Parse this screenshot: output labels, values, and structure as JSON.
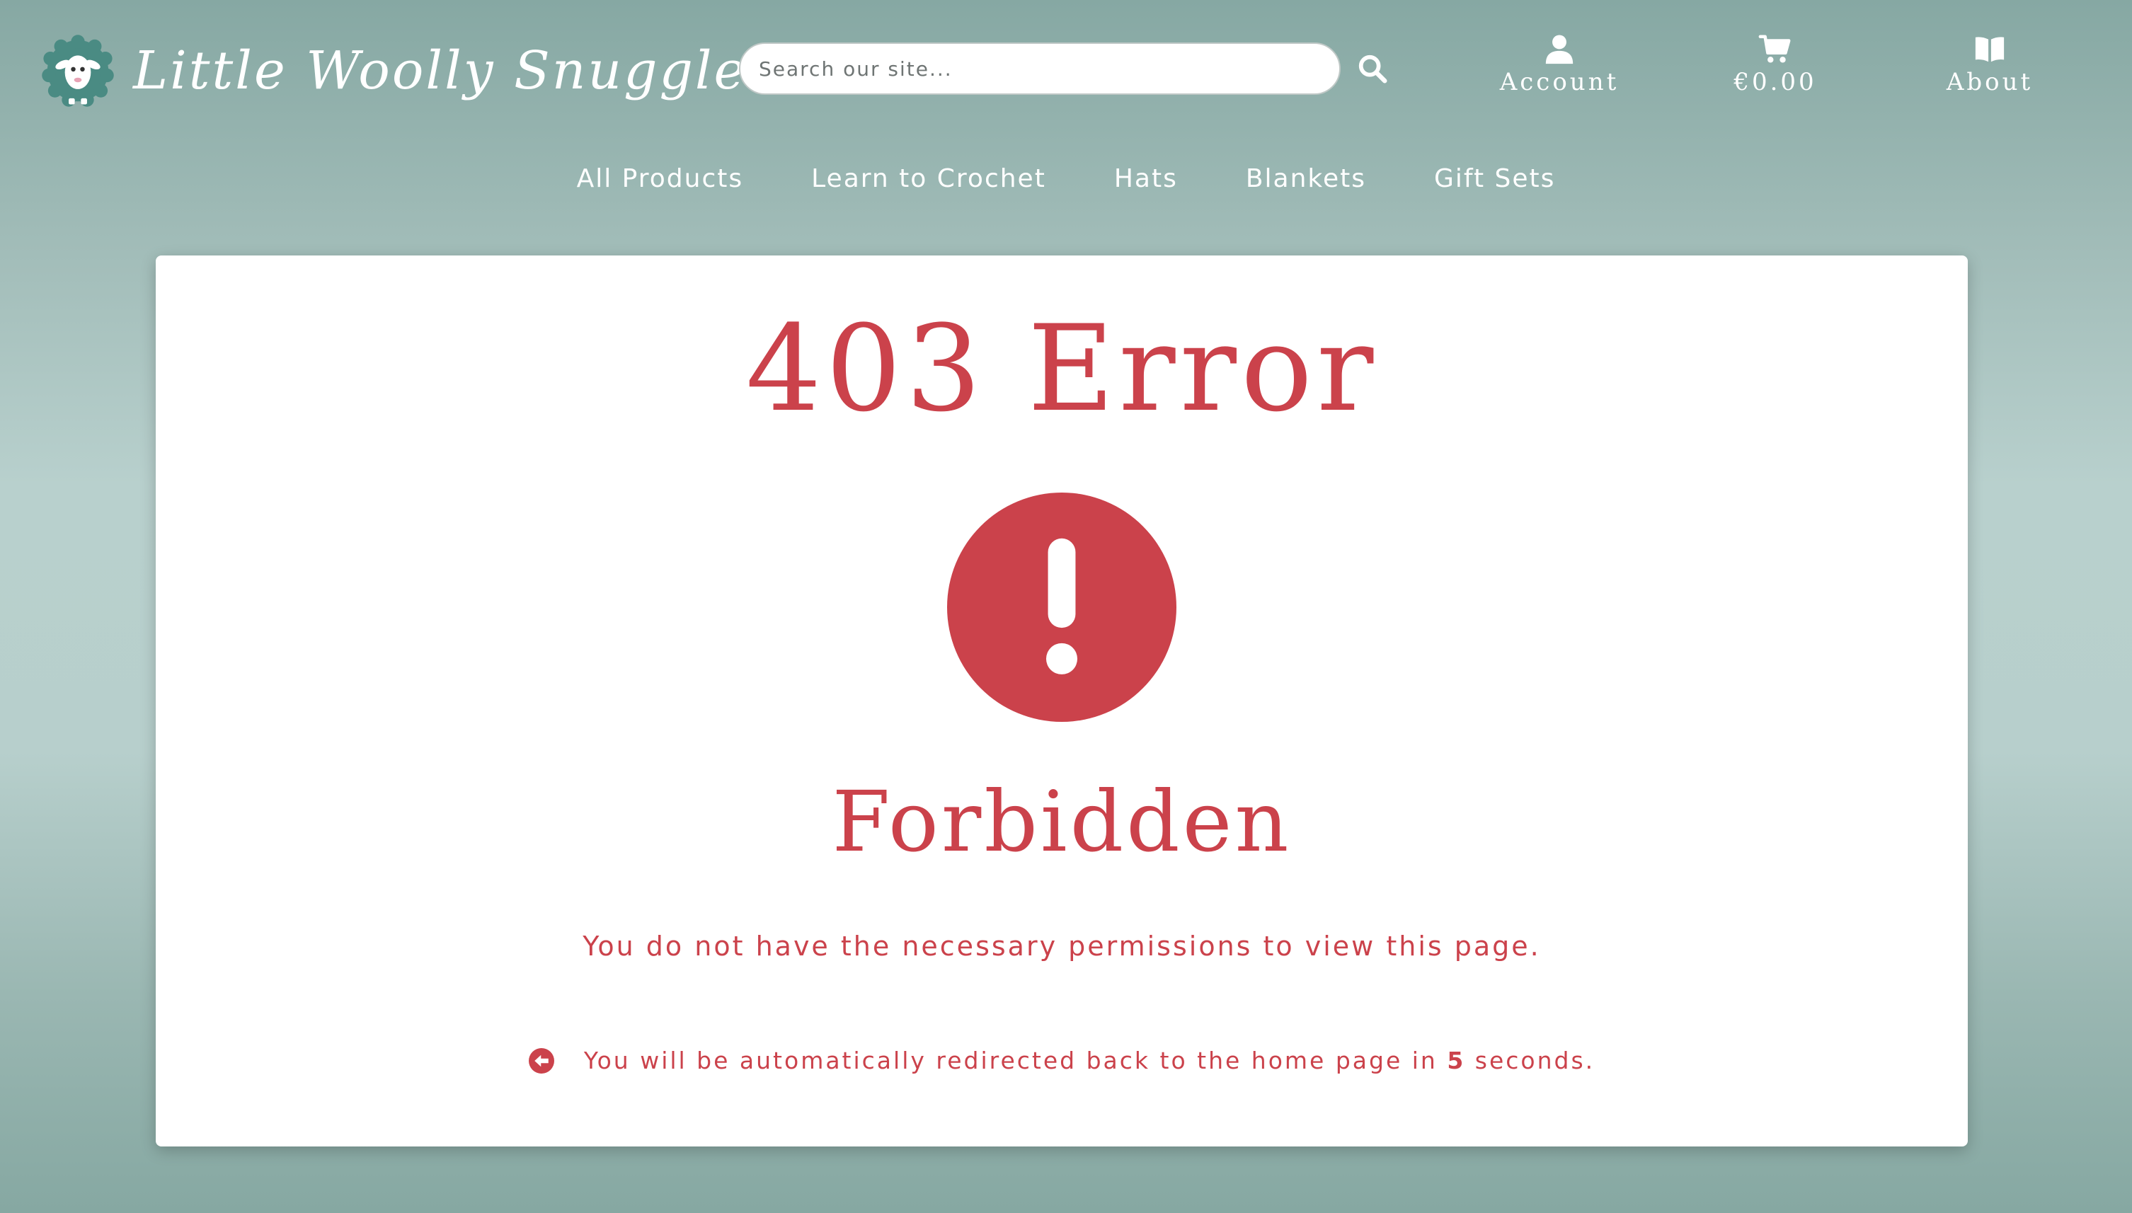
{
  "header": {
    "brand": "Little Woolly Snuggles",
    "search": {
      "placeholder": "Search our site..."
    },
    "account_label": "Account",
    "cart_total": "€0.00",
    "about_label": "About"
  },
  "nav": {
    "items": [
      {
        "label": "All Products"
      },
      {
        "label": "Learn to Crochet"
      },
      {
        "label": "Hats"
      },
      {
        "label": "Blankets"
      },
      {
        "label": "Gift Sets"
      }
    ]
  },
  "error": {
    "title": "403 Error",
    "heading": "Forbidden",
    "message": "You do not have the necessary permissions to view this page.",
    "redirect_prefix": "You will be automatically redirected back to the home page in",
    "redirect_seconds": "5",
    "redirect_suffix": "seconds."
  },
  "colors": {
    "accent": "#cb424b",
    "logo_teal": "#4a8b83"
  },
  "icons": {
    "logo": "sheep-logo-icon",
    "search": "search-icon",
    "account": "user-icon",
    "cart": "cart-icon",
    "about": "book-icon",
    "alert": "exclamation-circle-icon",
    "back": "arrow-left-circle-icon"
  }
}
